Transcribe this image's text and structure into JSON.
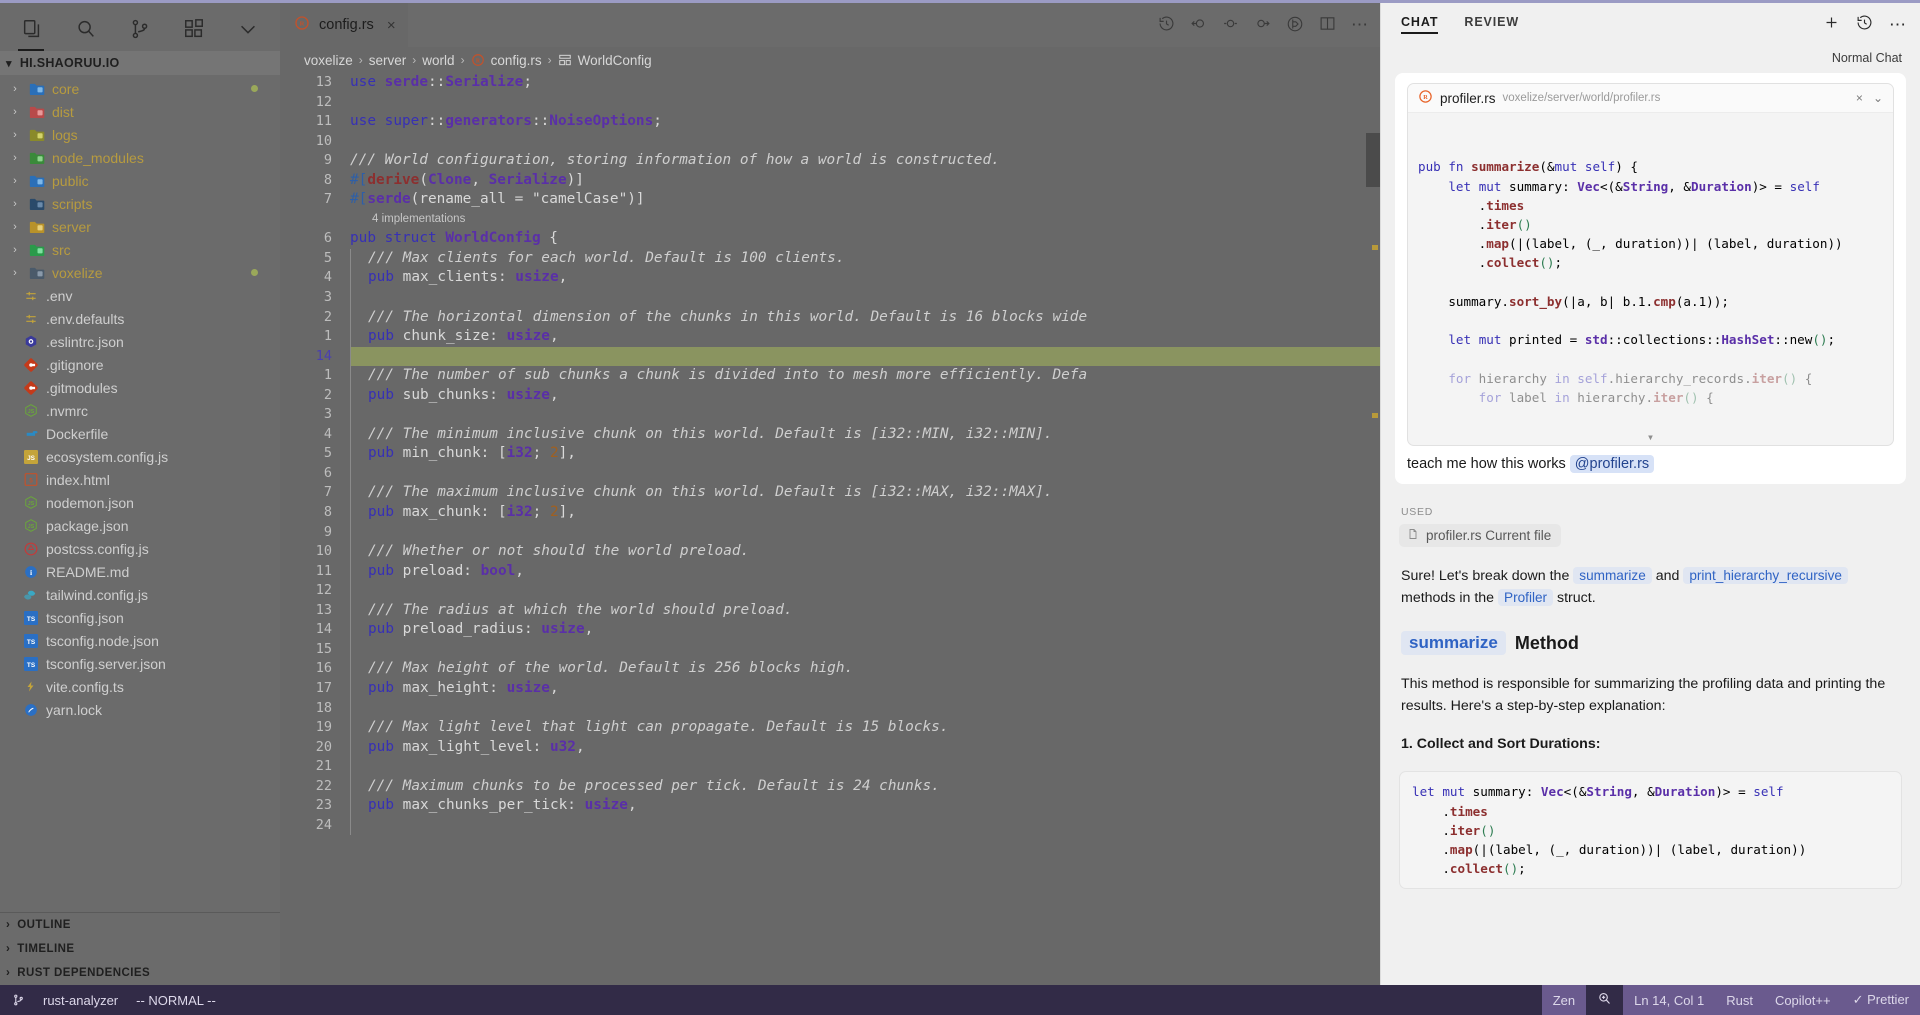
{
  "sidebar": {
    "icons": [
      {
        "name": "explorer-icon",
        "glyph": "files"
      },
      {
        "name": "search-icon",
        "glyph": "search"
      },
      {
        "name": "source-control-icon",
        "glyph": "branch"
      },
      {
        "name": "extensions-icon",
        "glyph": "blocks"
      },
      {
        "name": "chevron-down-icon",
        "glyph": "chevron"
      }
    ],
    "project": "HI.SHAORUU.IO",
    "folders": [
      {
        "label": "core",
        "color": "#2a6fb8",
        "accent": "#7fb8e8",
        "dot": "#9aa85a"
      },
      {
        "label": "dist",
        "color": "#b84a4a",
        "accent": "#e89a9a",
        "dot": ""
      },
      {
        "label": "logs",
        "color": "#8a8a2a",
        "accent": "#d4d46a",
        "dot": ""
      },
      {
        "label": "node_modules",
        "color": "#3a8a3a",
        "accent": "#8ed48e",
        "dot": ""
      },
      {
        "label": "public",
        "color": "#2a6fb8",
        "accent": "#7fb8e8",
        "dot": ""
      },
      {
        "label": "scripts",
        "color": "#2a4a6a",
        "accent": "#6a8aaa",
        "dot": ""
      },
      {
        "label": "server",
        "color": "#b8922a",
        "accent": "#e8d07a",
        "dot": ""
      },
      {
        "label": "src",
        "color": "#2a9a4a",
        "accent": "#7fe0a0",
        "dot": ""
      },
      {
        "label": "voxelize",
        "color": "#4a5a6a",
        "accent": "#8a9aaa",
        "dot": "#9aa85a"
      }
    ],
    "files": [
      {
        "label": ".env",
        "icon": "settings",
        "color": "#c4a43a"
      },
      {
        "label": ".env.defaults",
        "icon": "settings",
        "color": "#c4a43a"
      },
      {
        "label": ".eslintrc.json",
        "icon": "eslint",
        "color": "#3a3a9a"
      },
      {
        "label": ".gitignore",
        "icon": "git",
        "color": "#c43a1a"
      },
      {
        "label": ".gitmodules",
        "icon": "git",
        "color": "#c43a1a"
      },
      {
        "label": ".nvmrc",
        "icon": "node",
        "color": "#6aa83a"
      },
      {
        "label": "Dockerfile",
        "icon": "docker",
        "color": "#2a8ac4"
      },
      {
        "label": "ecosystem.config.js",
        "icon": "js",
        "color": "#c4a43a"
      },
      {
        "label": "index.html",
        "icon": "html",
        "color": "#c4512a"
      },
      {
        "label": "nodemon.json",
        "icon": "node",
        "color": "#6aa83a"
      },
      {
        "label": "package.json",
        "icon": "node",
        "color": "#6aa83a"
      },
      {
        "label": "postcss.config.js",
        "icon": "postcss",
        "color": "#c43a3a"
      },
      {
        "label": "README.md",
        "icon": "info",
        "color": "#2a6fc4"
      },
      {
        "label": "tailwind.config.js",
        "icon": "tailwind",
        "color": "#3aa8c4"
      },
      {
        "label": "tsconfig.json",
        "icon": "ts",
        "color": "#2a6fc4"
      },
      {
        "label": "tsconfig.node.json",
        "icon": "ts",
        "color": "#2a6fc4"
      },
      {
        "label": "tsconfig.server.json",
        "icon": "ts",
        "color": "#2a6fc4"
      },
      {
        "label": "vite.config.ts",
        "icon": "vite",
        "color": "#c4a43a"
      },
      {
        "label": "yarn.lock",
        "icon": "yarn",
        "color": "#2a6fc4"
      }
    ],
    "panels": [
      "OUTLINE",
      "TIMELINE",
      "RUST DEPENDENCIES"
    ]
  },
  "editor": {
    "tab": {
      "filename": "config.rs",
      "icon": "rust-icon",
      "close": "×"
    },
    "breadcrumb": [
      "voxelize",
      "server",
      "world",
      "config.rs",
      "WorldConfig"
    ],
    "codelens": "4 implementations",
    "gutter": [
      "13",
      "12",
      "11",
      "10",
      "9",
      "8",
      "7",
      "",
      "6",
      "5",
      "4",
      "3",
      "2",
      "1",
      "14",
      "1",
      "2",
      "3",
      "4",
      "5",
      "6",
      "7",
      "8",
      "9",
      "10",
      "11",
      "12",
      "13",
      "14",
      "15",
      "16",
      "17",
      "18",
      "19",
      "20",
      "21",
      "22",
      "23",
      "24"
    ],
    "cursor_gutter_index": 14,
    "lines": [
      "use serde::Serialize;",
      "",
      "use super::generators::NoiseOptions;",
      "",
      "/// World configuration, storing information of how a world is constructed.",
      "#[derive(Clone, Serialize)]",
      "#[serde(rename_all = \"camelCase\")]",
      "pub struct WorldConfig {",
      "    /// Max clients for each world. Default is 100 clients.",
      "    pub max_clients: usize,",
      "",
      "    /// The horizontal dimension of the chunks in this world. Default is 16 blocks wide",
      "    pub chunk_size: usize,",
      "",
      "    /// The number of sub chunks a chunk is divided into to mesh more efficiently. Defa",
      "    pub sub_chunks: usize,",
      "",
      "    /// The minimum inclusive chunk on this world. Default is [i32::MIN, i32::MIN].",
      "    pub min_chunk: [i32; 2],",
      "",
      "    /// The maximum inclusive chunk on this world. Default is [i32::MAX, i32::MAX].",
      "    pub max_chunk: [i32; 2],",
      "",
      "    /// Whether or not should the world preload.",
      "    pub preload: bool,",
      "",
      "    /// The radius at which the world should preload.",
      "    pub preload_radius: usize,",
      "",
      "    /// Max height of the world. Default is 256 blocks high.",
      "    pub max_height: usize,",
      "",
      "    /// Max light level that light can propagate. Default is 15 blocks.",
      "    pub max_light_level: u32,",
      "",
      "    /// Maximum chunks to be processed per tick. Default is 24 chunks.",
      "    pub max_chunks_per_tick: usize,",
      ""
    ]
  },
  "chat": {
    "tabs": [
      {
        "label": "CHAT",
        "active": true
      },
      {
        "label": "REVIEW",
        "active": false
      }
    ],
    "head_actions": [
      {
        "name": "new-chat-icon",
        "glyph": "+"
      },
      {
        "name": "history-icon",
        "glyph": "history"
      },
      {
        "name": "more-icon",
        "glyph": "⋯"
      }
    ],
    "mode_label": "Normal Chat",
    "attachment": {
      "filename": "profiler.rs",
      "path": "voxelize/server/world/profiler.rs",
      "close_icon": "×",
      "chevron_icon": "⌄",
      "code": [
        "pub fn summarize(&mut self) {",
        "    let mut summary: Vec<(&String, &Duration)> = self",
        "        .times",
        "        .iter()",
        "        .map(|(label, (_, duration))| (label, duration))",
        "        .collect();",
        "",
        "    summary.sort_by(|a, b| b.1.cmp(a.1));",
        "",
        "    let mut printed = std::collections::HashSet::new();",
        "",
        "    for hierarchy in self.hierarchy_records.iter() {",
        "        for label in hierarchy.iter() {"
      ]
    },
    "prompt": {
      "text": "teach me how this works",
      "mention": "@profiler.rs"
    },
    "used": {
      "label": "USED",
      "chip": "profiler.rs Current file",
      "icon": "file-icon"
    },
    "response": {
      "intro_pre": "Sure! Let's break down the ",
      "intro_code1": "summarize",
      "intro_mid": " and ",
      "intro_code2": "print_hierarchy_recursive",
      "intro_post": " methods in the ",
      "intro_code3": "Profiler",
      "intro_end": " struct.",
      "heading_code": "summarize",
      "heading_text": "Method",
      "body": "This method is responsible for summarizing the profiling data and printing the results. Here's a step-by-step explanation:",
      "list_item": "1. Collect and Sort Durations:",
      "code": [
        "let mut summary: Vec<(&String, &Duration)> = self",
        "    .times",
        "    .iter()",
        "    .map(|(label, (_, duration))| (label, duration))",
        "    .collect();"
      ]
    }
  },
  "status": {
    "git_branch_icon": "branch-icon",
    "left": [
      "rust-analyzer",
      "-- NORMAL --"
    ],
    "right": [
      {
        "label": "Zen",
        "name": "status-zen"
      },
      {
        "label": "",
        "name": "status-zoom",
        "icon": "zoom-in-icon"
      },
      {
        "label": "Ln 14, Col 1",
        "name": "status-cursor-position"
      },
      {
        "label": "Rust",
        "name": "status-language-mode"
      },
      {
        "label": "Copilot++",
        "name": "status-copilot"
      },
      {
        "label": "✓ Prettier",
        "name": "status-prettier"
      }
    ]
  }
}
